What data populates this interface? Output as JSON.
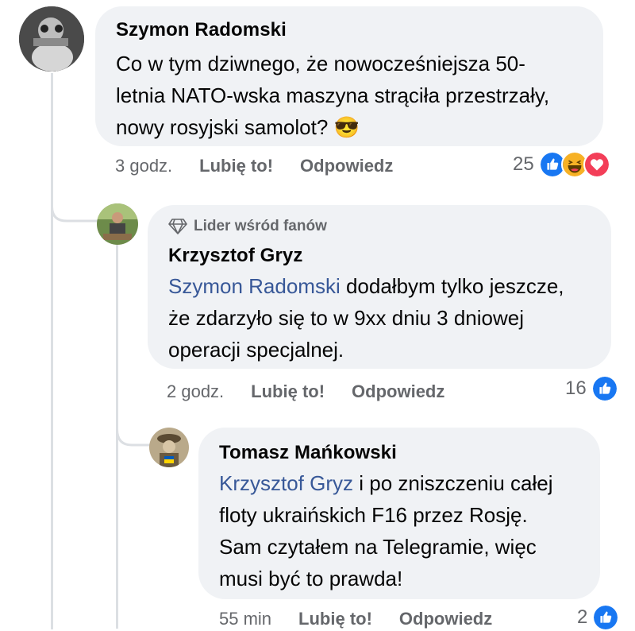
{
  "comments": [
    {
      "author": "Szymon Radomski",
      "text": "Co w tym dziwnego, że nowocześniejsza 50-letnia NATO-wska maszyna strąciła przestrzały, nowy rosyjski samolot?",
      "text_line1": "Co w tym dziwnego, że nowocześniejsza 50-",
      "text_line2": "letnia NATO-wska maszyna strąciła przestrzały,",
      "text_line3": "nowy rosyjski samolot?",
      "emoji": "😎",
      "time": "3 godz.",
      "like_label": "Lubię to!",
      "reply_label": "Odpowiedz",
      "reaction_count": "25",
      "reactions": [
        "like-icon",
        "haha-icon",
        "love-icon"
      ]
    },
    {
      "badge": "Lider wśród fanów",
      "author": "Krzysztof Gryz",
      "mention": "Szymon Radomski",
      "text_line1_rest": " dodałbym tylko jeszcze,",
      "text_line2": "że zdarzyło się to w 9xx dniu 3 dniowej",
      "text_line3": "operacji specjalnej.",
      "time": "2 godz.",
      "like_label": "Lubię to!",
      "reply_label": "Odpowiedz",
      "reaction_count": "16",
      "reactions": [
        "like-icon"
      ]
    },
    {
      "author": "Tomasz Mańkowski",
      "mention": "Krzysztof Gryz",
      "text_line1_rest": " i po zniszczeniu całej",
      "text_line2": "floty ukraińskich F16 przez Rosję.",
      "text_line3": "Sam czytałem na Telegramie, więc",
      "text_line4": "musi być to prawda!",
      "time": "55 min",
      "like_label": "Lubię to!",
      "reply_label": "Odpowiedz",
      "reaction_count": "2",
      "reactions": [
        "like-icon"
      ]
    }
  ],
  "colors": {
    "bubble": "#f0f2f5",
    "mention": "#385898",
    "meta": "#65676b",
    "like": "#1877f2",
    "love": "#f33e58",
    "haha": "#f7b125"
  }
}
